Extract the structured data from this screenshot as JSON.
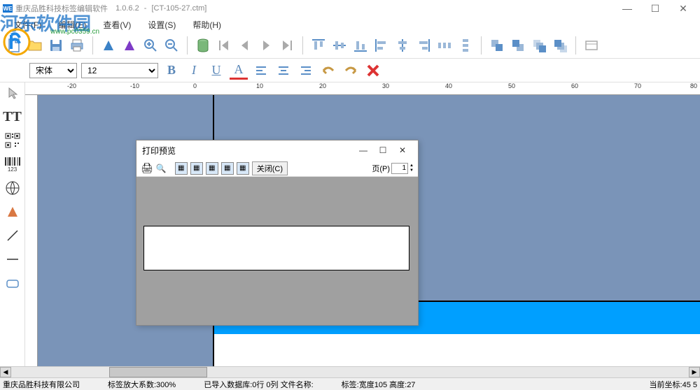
{
  "titlebar": {
    "app_name": "重庆品胜科技标签编辑软件",
    "version": "1.0.6.2",
    "document": "[CT-105-27.ctm]",
    "logo": "WE"
  },
  "menu": {
    "file": "文件(F)",
    "edit": "编辑(E)",
    "view": "查看(V)",
    "settings": "设置(S)",
    "help": "帮助(H)"
  },
  "watermark": {
    "text": "河东软件园",
    "url": "www.pc0359.cn"
  },
  "toolbar2": {
    "font": "宋体",
    "size": "12"
  },
  "ruler": {
    "ticks": [
      "-20",
      "",
      "-10",
      "",
      "0",
      "",
      "10",
      "",
      "20",
      "",
      "30",
      "",
      "40",
      "",
      "50",
      "",
      "60",
      "",
      "70",
      "",
      "80"
    ]
  },
  "preview": {
    "title": "打印预览",
    "close_btn": "关闭(C)",
    "page_label": "页(P)",
    "page_value": "1"
  },
  "statusbar": {
    "company": "重庆品胜科技有限公司",
    "zoom": "标签放大系数:300%",
    "data": "已导入数据库:0行 0列 文件名称:",
    "label_size": "标签:宽度105 高度:27",
    "coords": "当前坐标:45 5"
  }
}
